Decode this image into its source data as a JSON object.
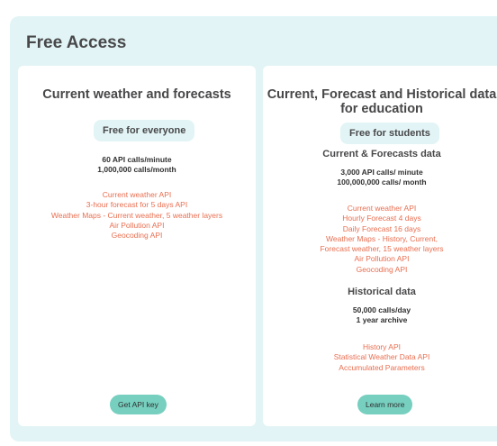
{
  "section": {
    "title": "Free Access"
  },
  "cards": [
    {
      "title": "Current weather and forecasts",
      "badge": "Free for everyone",
      "stats": [
        "60 API calls/minute",
        "1,000,000 calls/month"
      ],
      "links": [
        "Current weather API",
        "3-hour forecast for 5 days API",
        "Weather Maps - Current weather, 5 weather layers",
        "Air Pollution API",
        "Geocoding API"
      ],
      "button": "Get API key"
    },
    {
      "title_line1": "Current, Forecast and Historical data",
      "title_line2": "for education",
      "badge": "Free for students",
      "forecast_heading": "Current & Forecasts data",
      "forecast_stats": [
        "3,000 API calls/ minute",
        "100,000,000 calls/ month"
      ],
      "forecast_links": [
        "Current weather API",
        "Hourly Forecast 4 days",
        "Daily Forecast 16 days",
        "Weather Maps - History, Current,",
        "Forecast weather, 15 weather layers",
        "Air Pollution API",
        "Geocoding API"
      ],
      "historical_heading": "Historical data",
      "historical_stats": [
        "50,000 calls/day",
        "1 year archive"
      ],
      "historical_links": [
        "History API",
        "Statistical Weather Data API",
        "Accumulated Parameters"
      ],
      "button": "Learn more"
    }
  ],
  "colors": {
    "background": "#e2f4f5",
    "link": "#e96e50",
    "button": "#76cfbf",
    "text": "#48484a"
  }
}
